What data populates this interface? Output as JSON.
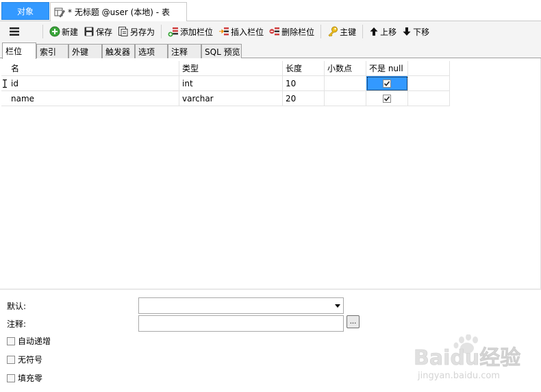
{
  "doc_tabs": {
    "objects_label": "对象",
    "table_label": "* 无标题 @user (本地) - 表"
  },
  "toolbar": {
    "new_label": "新建",
    "save_label": "保存",
    "save_as_label": "另存为",
    "add_field_label": "添加栏位",
    "insert_field_label": "插入栏位",
    "delete_field_label": "删除栏位",
    "primary_key_label": "主键",
    "move_up_label": "上移",
    "move_down_label": "下移"
  },
  "inner_tabs": [
    "栏位",
    "索引",
    "外键",
    "触发器",
    "选项",
    "注释",
    "SQL 预览"
  ],
  "grid": {
    "headers": {
      "name": "名",
      "type": "类型",
      "length": "长度",
      "decimals": "小数点",
      "not_null": "不是 null"
    },
    "rows": [
      {
        "name": "id",
        "type": "int",
        "length": "10",
        "decimals": "",
        "not_null": true,
        "selected": true
      },
      {
        "name": "name",
        "type": "varchar",
        "length": "20",
        "decimals": "",
        "not_null": true,
        "selected": false
      }
    ]
  },
  "properties": {
    "default_label": "默认:",
    "default_value": "",
    "comment_label": "注释:",
    "comment_value": "",
    "ellipsis_label": "...",
    "auto_increment_label": "自动递增",
    "unsigned_label": "无符号",
    "zerofill_label": "填充零"
  },
  "watermark": {
    "brand": "Baidu经验",
    "url": "jingyan.baidu.com"
  },
  "colors": {
    "accent": "#3399ff",
    "toolbar_bg": "#f4f4f4"
  }
}
